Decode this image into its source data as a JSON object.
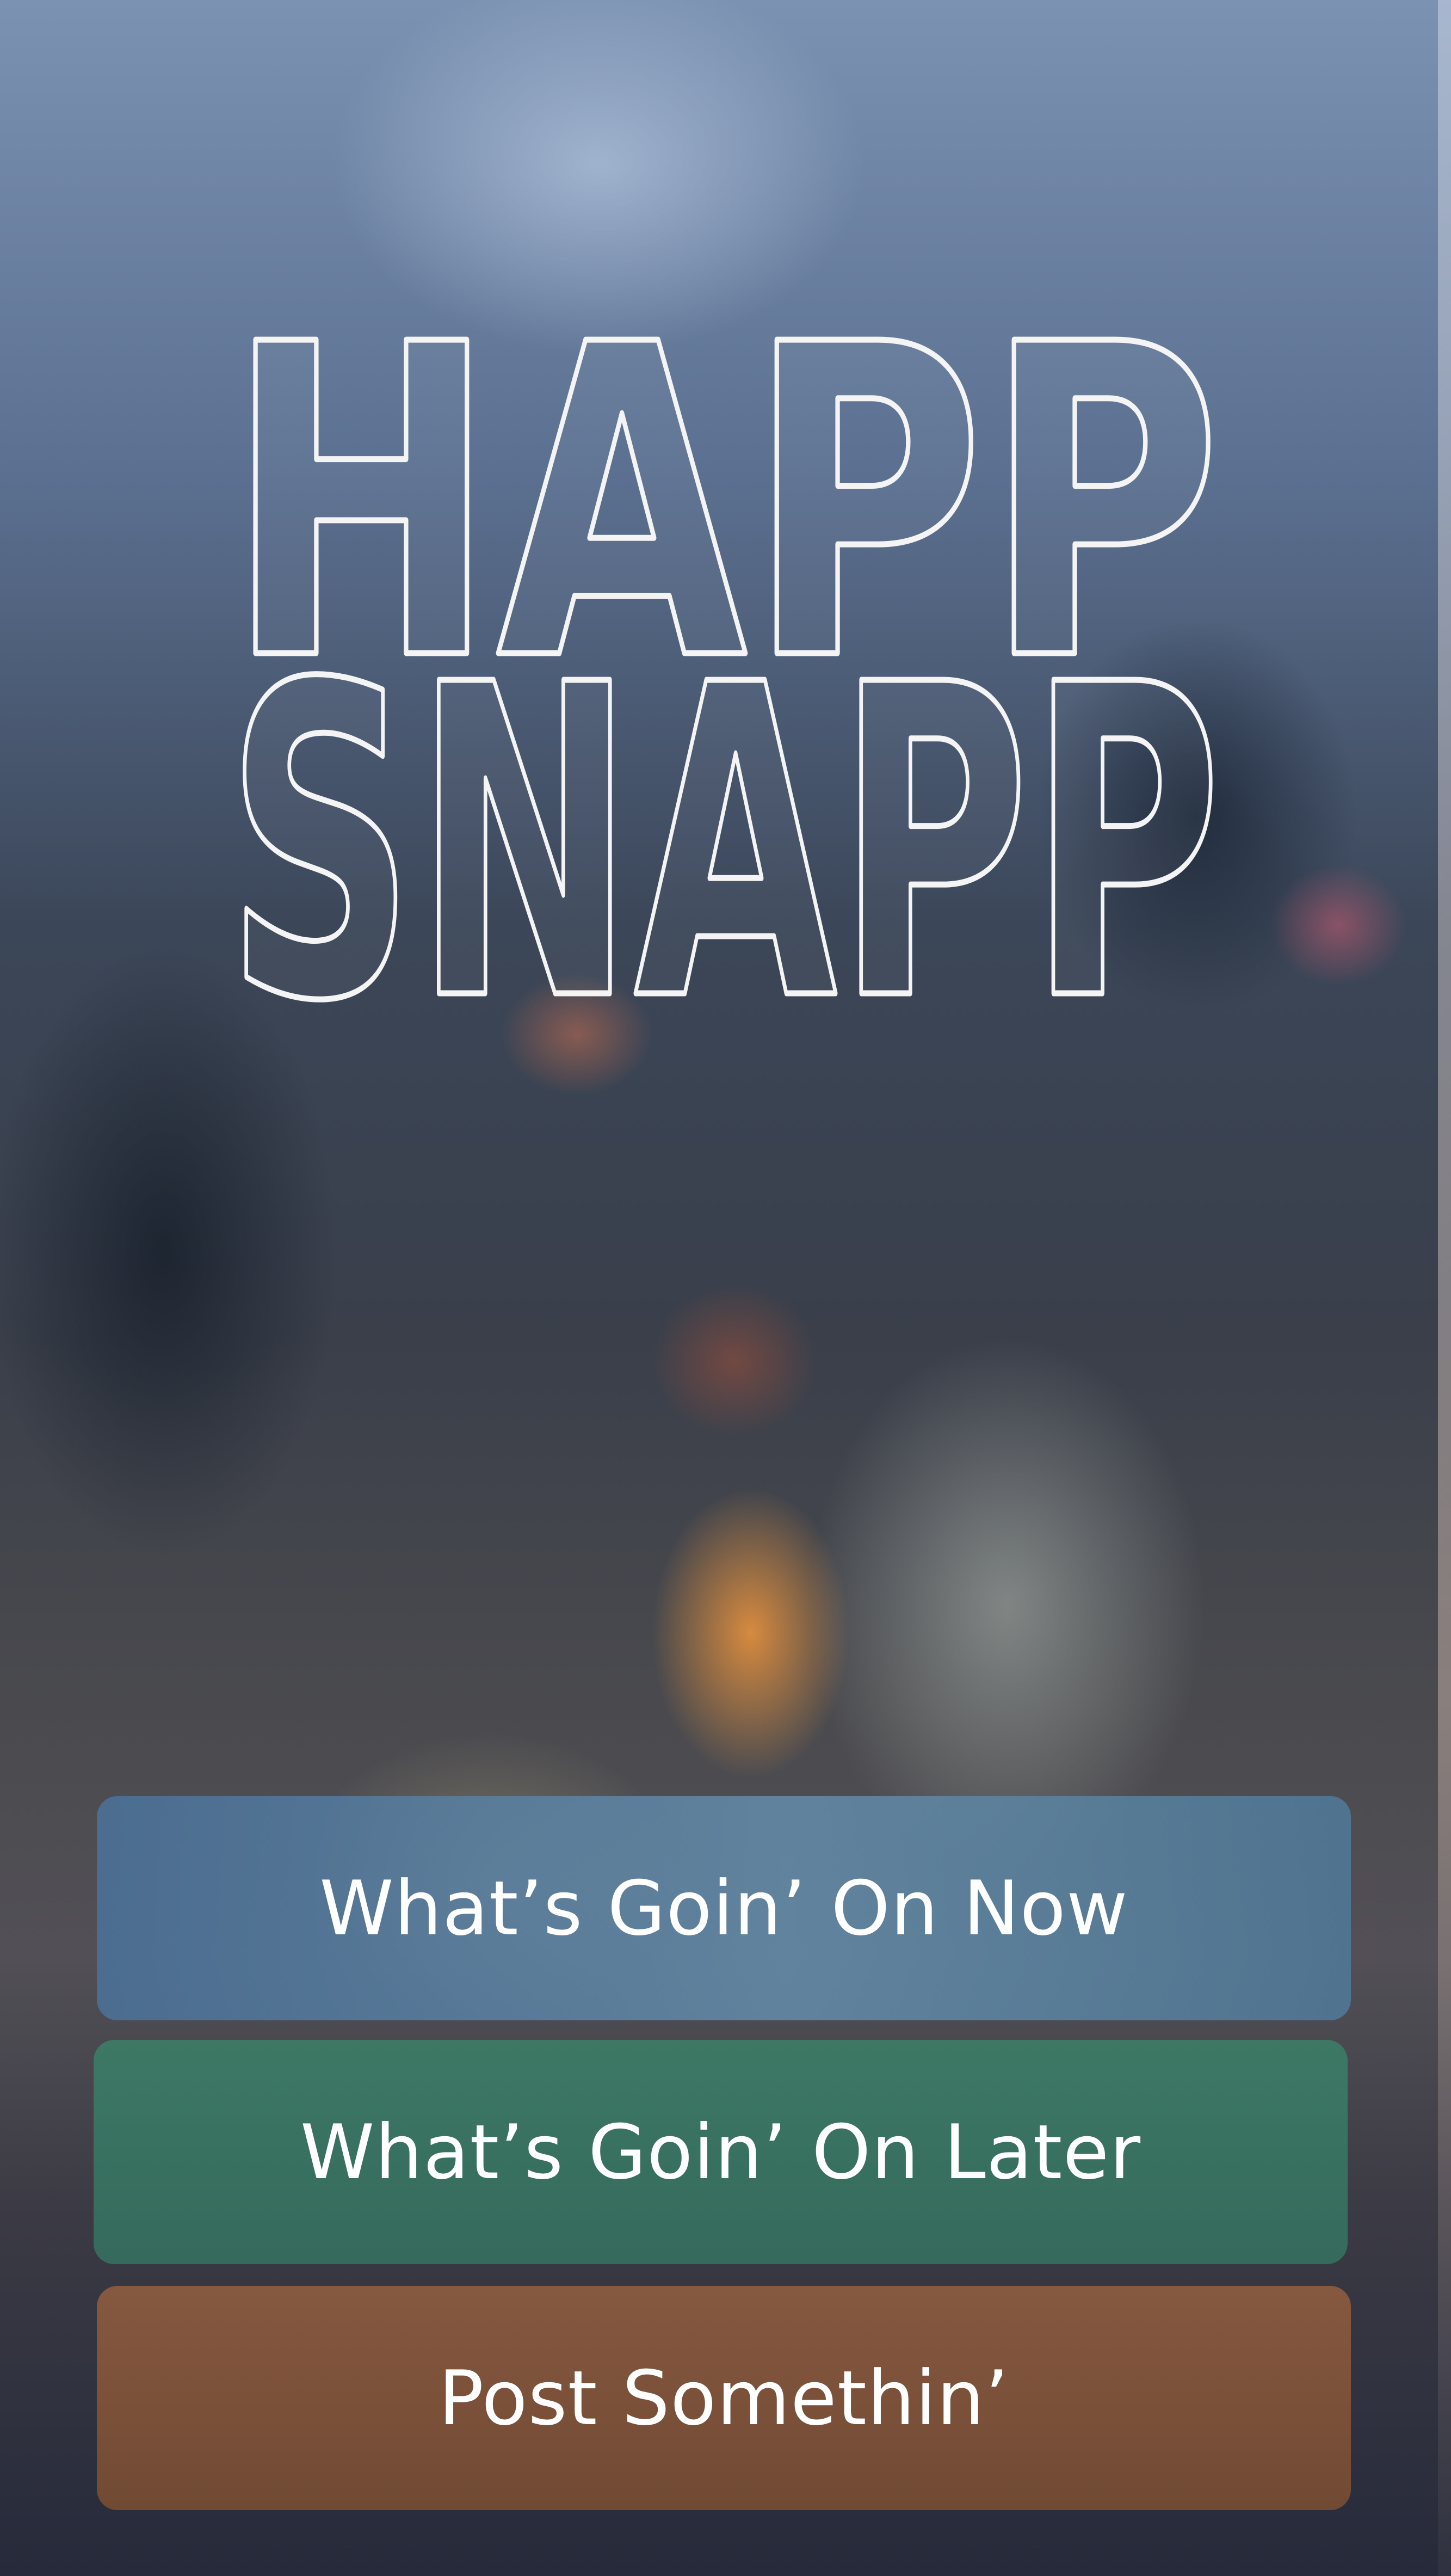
{
  "app": {
    "logo_line1": "HAPP",
    "logo_line2": "SNAPP"
  },
  "actions": {
    "now_label": "What’s Goin’ On Now",
    "later_label": "What’s Goin’ On Later",
    "post_label": "Post Somethin’"
  },
  "colors": {
    "now_button": "#5a81a0",
    "later_button": "#3a7262",
    "post_button": "#7d5239",
    "logo_outline": "#f4f4f4"
  }
}
